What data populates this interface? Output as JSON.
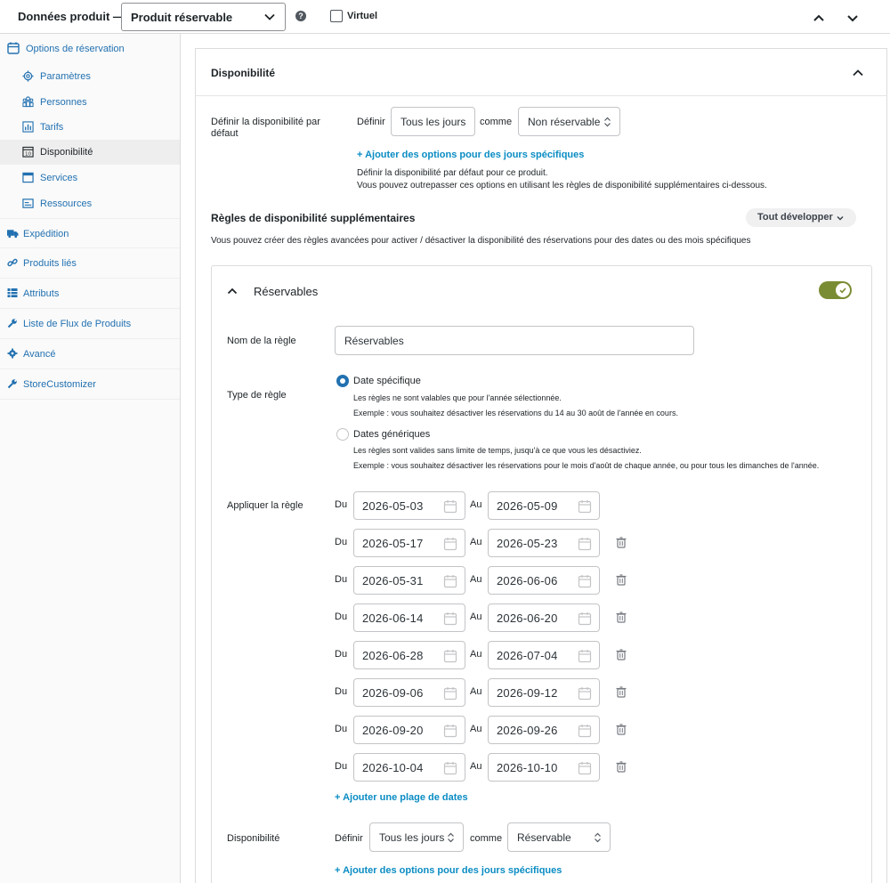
{
  "header": {
    "title": "Données produit —",
    "product_type": "Produit réservable",
    "help": "?",
    "virtual_label": "Virtuel"
  },
  "sidebar": {
    "booking_options": "Options de réservation",
    "sub_items": [
      "Paramètres",
      "Personnes",
      "Tarifs",
      "Disponibilité",
      "Services",
      "Ressources"
    ],
    "items": [
      "Expédition",
      "Produits liés",
      "Attributs",
      "Liste de Flux de Produits",
      "Avancé",
      "StoreCustomizer"
    ]
  },
  "availability": {
    "title": "Disponibilité",
    "default_label": "Définir la disponibilité par défaut",
    "define": "Définir",
    "all_days": "Tous les jours",
    "as": "comme",
    "not_bookable": "Non réservable",
    "add_link": "+ Ajouter des options pour des jours spécifiques",
    "help1": "Définir la disponibilité par défaut pour ce produit.",
    "help2": "Vous pouvez outrepasser ces options en utilisant les règles de disponibilité supplémentaires ci-dessous."
  },
  "rules": {
    "title": "Règles de disponibilité supplémentaires",
    "expand_all": "Tout développer",
    "description": "Vous pouvez créer des règles avancées pour activer / désactiver la disponibilité des réservations pour des dates ou des mois spécifiques"
  },
  "rule": {
    "title": "Réservables",
    "name_label": "Nom de la règle",
    "name_value": "Réservables",
    "type_label": "Type de règle",
    "opt1_label": "Date spécifique",
    "opt1_help1": "Les règles ne sont valables que pour l'année sélectionnée.",
    "opt1_help2": "Exemple : vous souhaitez désactiver les réservations du 14 au 30 août de l'année en cours.",
    "opt2_label": "Dates génériques",
    "opt2_help1": "Les règles sont valides sans limite de temps, jusqu'à ce que vous les désactiviez.",
    "opt2_help2": "Exemple : vous souhaitez désactiver les réservations pour le mois d'août de chaque année, ou pour tous les dimanches de l'année.",
    "apply_label": "Appliquer la règle",
    "from": "Du",
    "to": "Au",
    "ranges": [
      [
        "2026-05-03",
        "2026-05-09"
      ],
      [
        "2026-05-17",
        "2026-05-23"
      ],
      [
        "2026-05-31",
        "2026-06-06"
      ],
      [
        "2026-06-14",
        "2026-06-20"
      ],
      [
        "2026-06-28",
        "2026-07-04"
      ],
      [
        "2026-09-06",
        "2026-09-12"
      ],
      [
        "2026-09-20",
        "2026-09-26"
      ],
      [
        "2026-10-04",
        "2026-10-10"
      ]
    ],
    "add_range": "+ Ajouter une plage de dates",
    "avail_label": "Disponibilité",
    "define": "Définir",
    "all_days": "Tous les jours",
    "as": "comme",
    "bookable": "Réservable",
    "add_link": "+ Ajouter des options pour des jours spécifiques",
    "enabled": true
  },
  "colors": {
    "link": "#2271b1",
    "accent_link": "#0a8cc3",
    "toggle": "#7a8c33"
  }
}
